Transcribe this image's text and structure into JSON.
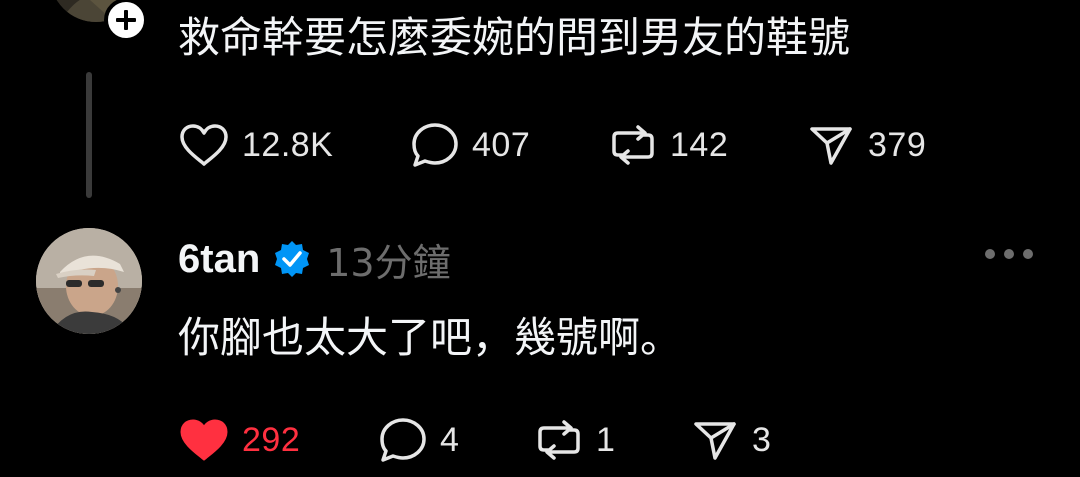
{
  "post": {
    "text": "救命幹要怎麼委婉的問到男友的鞋號",
    "likes": "12.8K",
    "comments": "407",
    "reposts": "142",
    "shares": "379"
  },
  "reply": {
    "username": "6tan",
    "timestamp": "13分鐘",
    "text": "你腳也太大了吧，幾號啊。",
    "likes": "292",
    "comments": "4",
    "reposts": "1",
    "shares": "3",
    "liked": true
  },
  "colors": {
    "background": "#000000",
    "text": "#f3f5f7",
    "muted": "#6d6d6d",
    "like_active": "#ff3040",
    "verified": "#0095f6"
  },
  "icons": {
    "like": "heart-icon",
    "comment": "comment-bubble-icon",
    "repost": "repost-icon",
    "share": "send-icon",
    "verified": "verified-badge-icon",
    "more": "more-options-icon",
    "follow": "plus-icon"
  }
}
